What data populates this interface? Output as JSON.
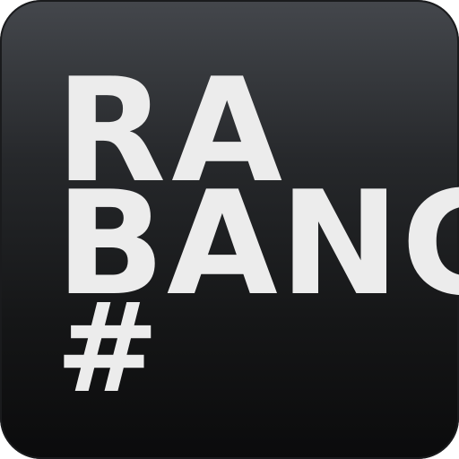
{
  "icon": {
    "line1": "RA",
    "line2": "BANG",
    "line3": "#"
  },
  "colors": {
    "background_top": "#44474c",
    "background_bottom": "#0b0b0c",
    "text": "#ececec"
  }
}
